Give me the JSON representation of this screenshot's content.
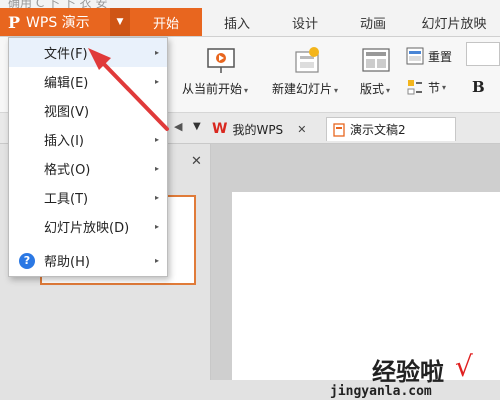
{
  "partial_top_text": "确用 C 卜 卜 衣 安",
  "app": {
    "title": "WPS 演示",
    "logo": "P",
    "dropdown_arrow": "▼"
  },
  "tabs": [
    "开始",
    "插入",
    "设计",
    "动画",
    "幻灯片放映"
  ],
  "active_tab": "开始",
  "ribbon": {
    "from_current_label": "从当前开始",
    "new_slide_label": "新建幻灯片",
    "layout_label": "版式",
    "section_label": "节",
    "reset_label": "重置",
    "bold_label": "B",
    "dropdown_glyph": "▾"
  },
  "doc_tabs": {
    "nav_arrow": "◀",
    "collapse_arrow": "▼",
    "my_wps_label": "我的WPS",
    "my_wps_close": "✕",
    "document_label": "演示文稿2"
  },
  "left_panel": {
    "close": "✕"
  },
  "menu": {
    "items": [
      {
        "label": "文件(F)",
        "has_submenu": true
      },
      {
        "label": "编辑(E)",
        "has_submenu": true
      },
      {
        "label": "视图(V)",
        "has_submenu": false
      },
      {
        "label": "插入(I)",
        "has_submenu": true
      },
      {
        "label": "格式(O)",
        "has_submenu": true
      },
      {
        "label": "工具(T)",
        "has_submenu": true
      },
      {
        "label": "幻灯片放映(D)",
        "has_submenu": true
      },
      {
        "label": "帮助(H)",
        "has_submenu": true
      }
    ],
    "submenu_glyph": "▸",
    "help_glyph": "?"
  },
  "watermark": {
    "cn": "经验啦",
    "check": "√",
    "url": "jingyanla.com"
  },
  "colors": {
    "accent": "#e8661f",
    "accent_dark": "#cf5515",
    "arrow_red": "#e03a3a",
    "help_blue": "#2b78e4"
  }
}
